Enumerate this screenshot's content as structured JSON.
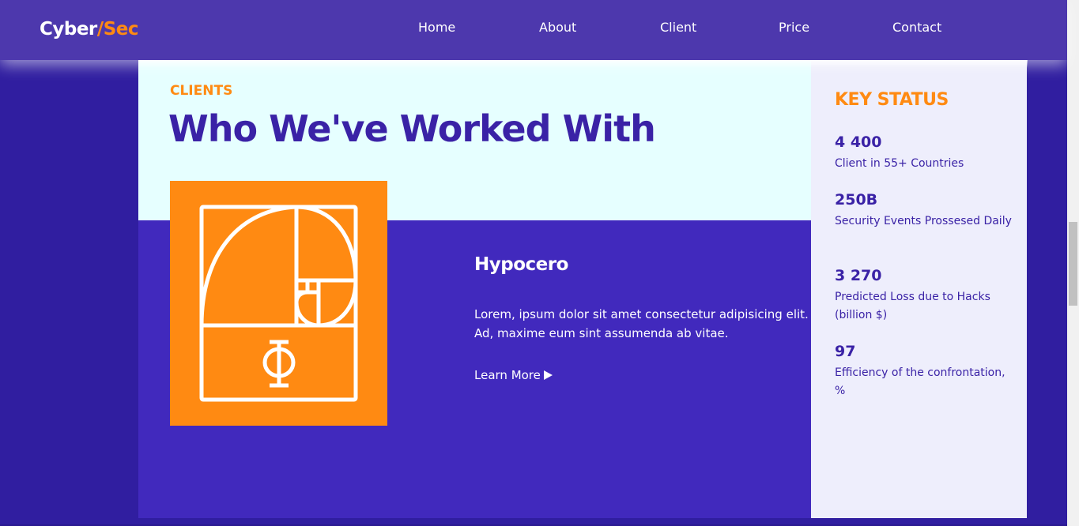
{
  "header": {
    "logo": {
      "part1": "Cyber",
      "separator": "/",
      "part2": "Sec"
    },
    "nav": [
      {
        "label": "Home"
      },
      {
        "label": "About"
      },
      {
        "label": "Client"
      },
      {
        "label": "Price"
      },
      {
        "label": "Contact"
      }
    ]
  },
  "clients": {
    "eyebrow": "CLIENTS",
    "title": "Who We've Worked With",
    "featured": {
      "logo_icon": "golden-ratio-phi-icon",
      "logo_glyph": "Φ",
      "name": "Hypocero",
      "description": "Lorem, ipsum dolor sit amet consectetur adipisicing elit. Ad, maxime eum sint assumenda ab vitae.",
      "cta": "Learn More",
      "cta_icon": "play-arrow-icon"
    }
  },
  "key_status": {
    "title": "KEY STATUS",
    "stats": [
      {
        "value": "4 400",
        "label": "Client in 55+ Countries"
      },
      {
        "value": "250B",
        "label": "Security Events Prossesed Daily"
      },
      {
        "value": "3 270",
        "label": "Predicted Loss due to Hacks (billion $)"
      },
      {
        "value": "97",
        "label": "Efficiency of the confrontation, %"
      }
    ]
  },
  "colors": {
    "accent": "#ff8a12",
    "brand_purple": "#3a22a6",
    "navbar": "#4d38ad",
    "page_background": "#301ea0",
    "panel_light": "#e6ffff",
    "panel_dark": "#4129bd",
    "sidebar": "#eeeefc"
  }
}
